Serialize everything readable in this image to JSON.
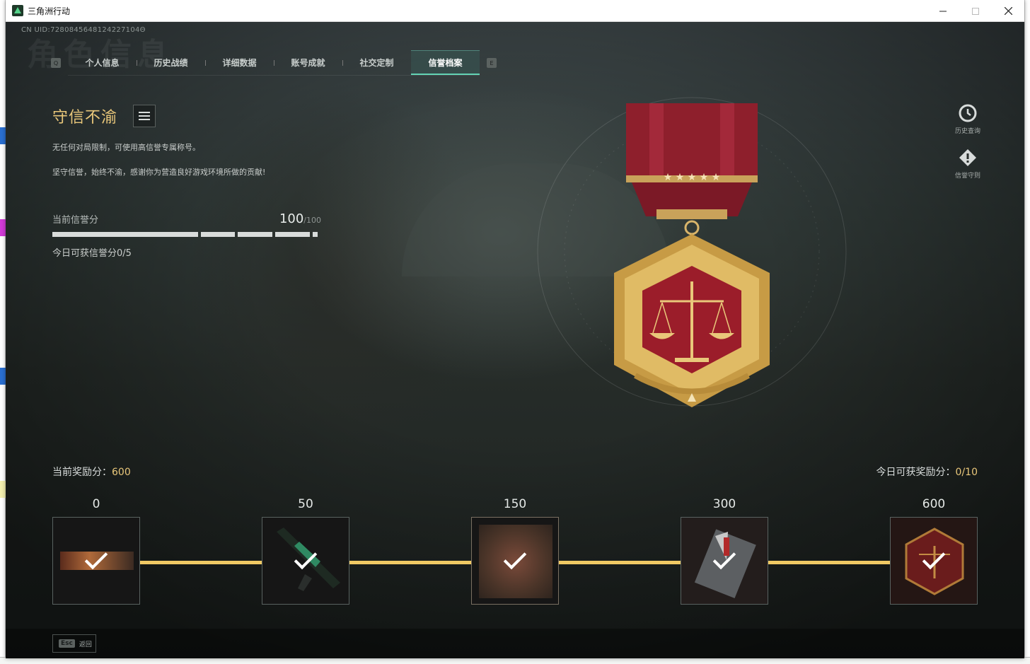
{
  "window": {
    "title": "三角洲行动"
  },
  "header": {
    "uid": "CN UID:7280845648124227104Θ",
    "ghost_title": "角色信息"
  },
  "tabs": {
    "left_key": "Q",
    "right_key": "E",
    "items": [
      {
        "label": "个人信息",
        "active": false
      },
      {
        "label": "历史战绩",
        "active": false
      },
      {
        "label": "详细数据",
        "active": false
      },
      {
        "label": "账号成就",
        "active": false
      },
      {
        "label": "社交定制",
        "active": false
      },
      {
        "label": "信誉档案",
        "active": true
      }
    ]
  },
  "credit": {
    "level_title": "守信不渝",
    "description_1": "无任何对局限制，可使用高信誉专属称号。",
    "description_2": "坚守信誉，始终不渝，感谢你为营造良好游戏环境所做的贡献!",
    "score_label": "当前信誉分",
    "score_value": "100",
    "score_max": "/100",
    "score_fraction": 1.0,
    "today_gain": "今日可获信誉分0/5"
  },
  "side": {
    "history_label": "历史查询",
    "rules_label": "信誉守则"
  },
  "rewards": {
    "current_label": "当前奖励分：",
    "current_value": "600",
    "today_label": "今日可获奖励分：",
    "today_value": "0/10",
    "tiers": [
      {
        "threshold": "0",
        "claimed": true,
        "icon": "banner-card"
      },
      {
        "threshold": "50",
        "claimed": true,
        "icon": "rifle-skin"
      },
      {
        "threshold": "150",
        "claimed": true,
        "icon": "scales-emblem"
      },
      {
        "threshold": "300",
        "claimed": true,
        "icon": "card-pendant"
      },
      {
        "threshold": "600",
        "claimed": true,
        "icon": "medal-badge"
      }
    ]
  },
  "footer": {
    "esc_key": "Esc",
    "esc_label": "返回"
  },
  "colors": {
    "gold": "#e9c77a",
    "track": "#f0c964",
    "tab_accent": "#63d3b4",
    "medal_red": "#9b1d2a"
  }
}
